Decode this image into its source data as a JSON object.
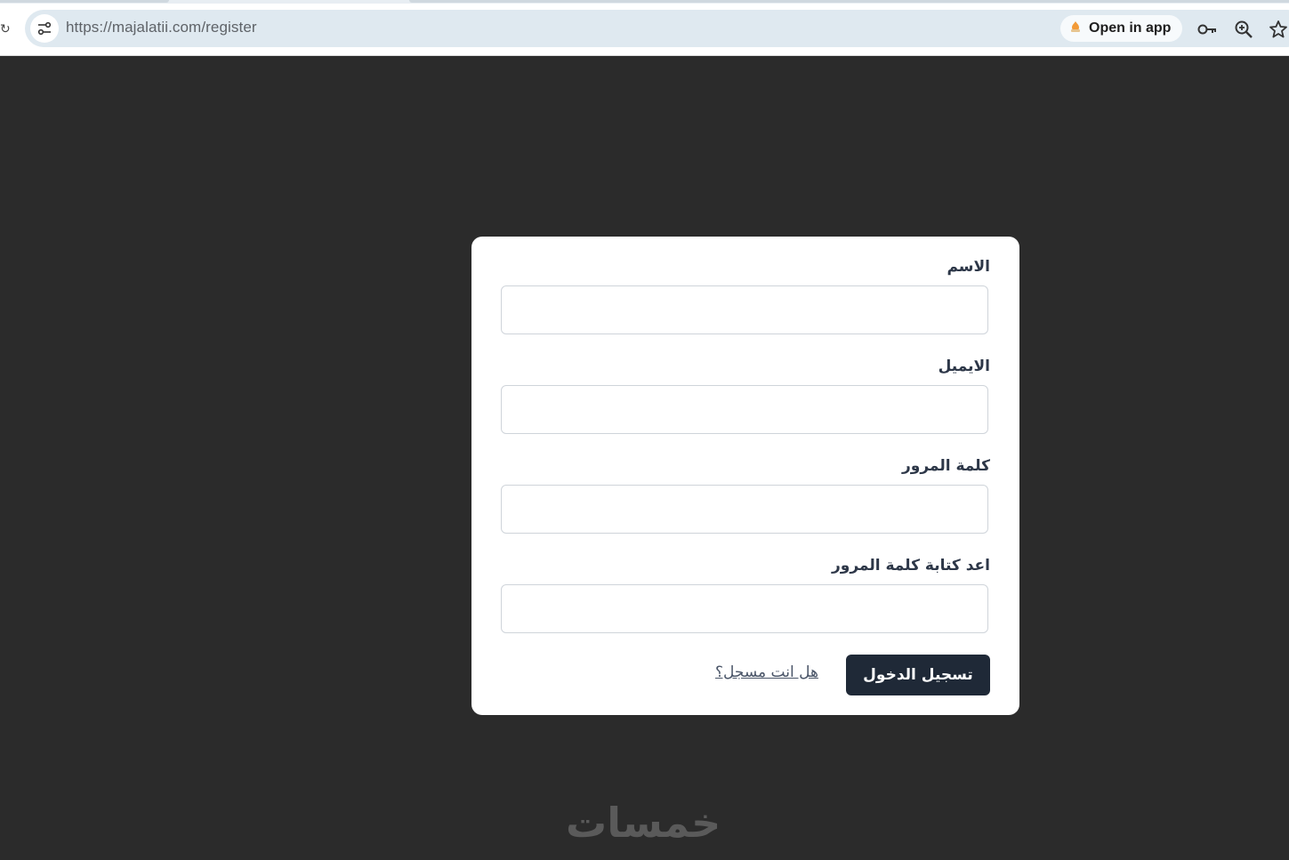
{
  "browser": {
    "url_host": "https://majalatii.com",
    "url_path": "/register",
    "open_in_app_label": "Open in app"
  },
  "form": {
    "name_label": "الاسم",
    "email_label": "الايميل",
    "password_label": "كلمة المرور",
    "confirm_password_label": "اعد كتابة كلمة المرور",
    "submit_label": "تسجيل الدخول",
    "login_link_label": "هل انت مسجل؟"
  },
  "watermark": {
    "text": "خمسات"
  },
  "colors": {
    "page_background": "#2b2b2b",
    "card_background": "#ffffff",
    "button_background": "#1f2937",
    "label_text": "#2d3748"
  }
}
